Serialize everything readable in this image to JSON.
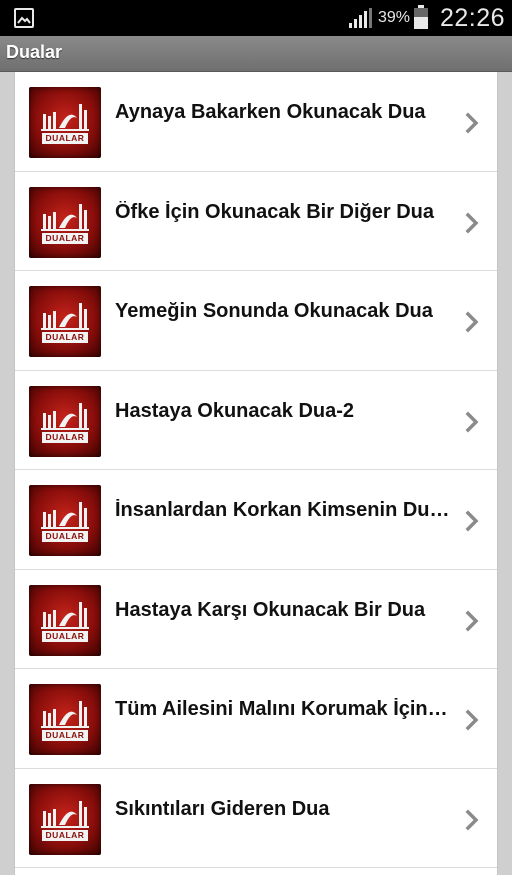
{
  "status_bar": {
    "notification_icon": "image-icon",
    "signal_icon": "signal-icon",
    "battery_percent": "39%",
    "battery_icon": "battery-icon",
    "time": "22:26"
  },
  "action_bar": {
    "title": "Dualar"
  },
  "colors": {
    "accent": "#8a0e0b",
    "action_bar": "#7a7a7a",
    "status_bar": "#000000"
  },
  "list": {
    "items": [
      {
        "title": "Aynaya Bakarken Okunacak Dua",
        "thumb_label": "DUALAR"
      },
      {
        "title": "Öfke İçin Okunacak Bir Diğer Dua",
        "thumb_label": "DUALAR"
      },
      {
        "title": "Yemeğin Sonunda Okunacak Dua",
        "thumb_label": "DUALAR"
      },
      {
        "title": "Hastaya Okunacak Dua-2",
        "thumb_label": "DUALAR"
      },
      {
        "title": "İnsanlardan Korkan Kimsenin Duası",
        "thumb_label": "DUALAR"
      },
      {
        "title": "Hastaya Karşı Okunacak Bir Dua",
        "thumb_label": "DUALAR"
      },
      {
        "title": "Tüm Ailesini Malını Korumak İçin Dua",
        "thumb_label": "DUALAR"
      },
      {
        "title": "Sıkıntıları Gideren Dua",
        "thumb_label": "DUALAR"
      }
    ]
  }
}
